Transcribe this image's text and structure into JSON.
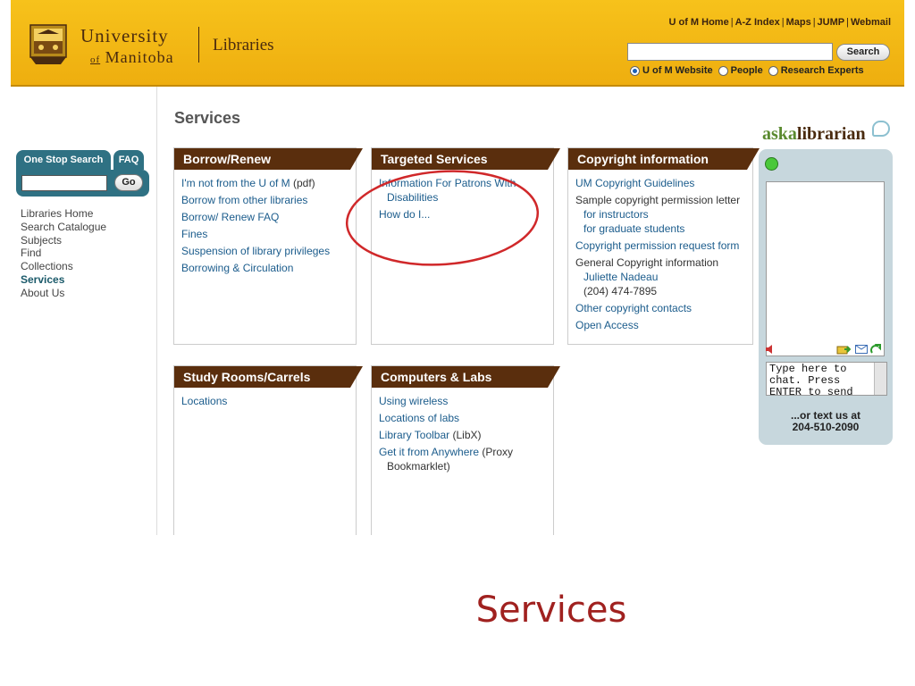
{
  "header": {
    "university_line1": "University",
    "university_line2_of": "of",
    "university_line2": "Manitoba",
    "library_name": "Libraries",
    "top_links": [
      "U of M Home",
      "A-Z Index",
      "Maps",
      "JUMP",
      "Webmail"
    ],
    "search_button": "Search",
    "search_value": "",
    "radios": [
      {
        "label": "U of M Website",
        "checked": true
      },
      {
        "label": "People",
        "checked": false
      },
      {
        "label": "Research Experts",
        "checked": false
      }
    ]
  },
  "sidebar": {
    "one_stop_tab": "One Stop Search",
    "faq_tab": "FAQ",
    "go_button": "Go",
    "nav_items": [
      {
        "label": "Libraries Home",
        "active": false
      },
      {
        "label": "Search Catalogue",
        "active": false
      },
      {
        "label": "Subjects",
        "active": false
      },
      {
        "label": "Find",
        "active": false
      },
      {
        "label": "Collections",
        "active": false
      },
      {
        "label": "Services",
        "active": true
      },
      {
        "label": "About Us",
        "active": false
      }
    ]
  },
  "main": {
    "title": "Services",
    "borrow": {
      "heading": "Borrow/Renew",
      "link1": "I'm not from the U of M",
      "link1_suffix": " (pdf)",
      "link2": "Borrow from other libraries",
      "link3": "Borrow/ Renew FAQ",
      "link4": "Fines",
      "link5": "Suspension of library privileges",
      "link6": "Borrowing & Circulation"
    },
    "targeted": {
      "heading": "Targeted Services",
      "link1": "Information For Patrons With",
      "link1_cont": "Disabilities",
      "link2": "How do I..."
    },
    "copyright": {
      "heading": "Copyright information",
      "link1": "UM Copyright Guidelines",
      "text1": "Sample copyright permission letter",
      "link2": "for instructors",
      "link3": "for graduate students",
      "link4": "Copyright permission request form",
      "text2": "General Copyright information",
      "link5": "Juliette Nadeau",
      "text3": "(204) 474-7895",
      "link6": "Other copyright contacts",
      "link7": "Open Access"
    },
    "study": {
      "heading": "Study Rooms/Carrels",
      "link1": "Locations"
    },
    "computers": {
      "heading": "Computers & Labs",
      "link1": "Using wireless",
      "link2": "Locations of labs",
      "link3": "Library Toolbar",
      "link3_suffix": " (LibX)",
      "link4": "Get it from Anywhere",
      "link4_suffix": " (Proxy",
      "link4_cont": "Bookmarklet)"
    }
  },
  "ask": {
    "title_part1": "aska",
    "title_part2": "librarian",
    "chat_placeholder": "Type here to chat.  Press ENTER to send",
    "text_us_line1": "...or text us at",
    "text_us_line2": "204-510-2090"
  },
  "caption": "Services",
  "colors": {
    "header_gold": "#f2b515",
    "heading_brown": "#5a2e0d",
    "link_blue": "#1b5c8c",
    "teal": "#2f7183",
    "highlight_red": "#d0282a",
    "caption_red": "#a0211f"
  }
}
